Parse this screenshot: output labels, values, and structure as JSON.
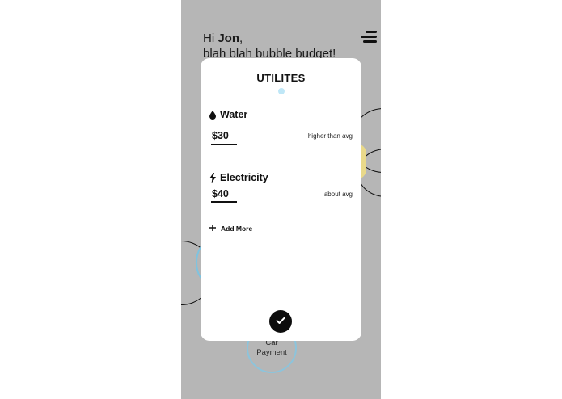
{
  "greeting": {
    "hi": "Hi",
    "name": "Jon",
    "comma": ",",
    "tagline": "blah blah bubble budget!"
  },
  "background": {
    "bubble_label_line1": "Car",
    "bubble_label_line2": "Payment"
  },
  "modal": {
    "title": "UTILITES",
    "items": [
      {
        "name": "Water",
        "icon": "droplet-icon",
        "amount": "$30",
        "note": "higher than avg"
      },
      {
        "name": "Electricity",
        "icon": "lightning-icon",
        "amount": "$40",
        "note": "about avg"
      }
    ],
    "add_more_label": "Add More",
    "confirm_icon": "checkmark-icon"
  },
  "colors": {
    "overlay": "#b6b6b6",
    "accent_blue": "#bfe7f7",
    "accent_yellow": "#e9d98a",
    "dark": "#0d0d0d"
  }
}
